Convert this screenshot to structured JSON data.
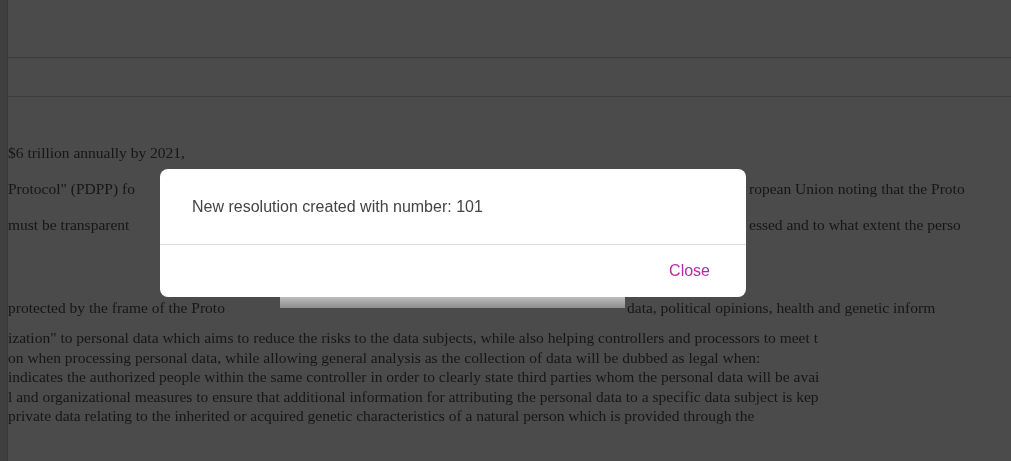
{
  "article": {
    "lines": [
      {
        "kind": "full",
        "left": "$6 trillion annually by 2021,"
      },
      {
        "kind": "split_dialog",
        "left": "Protocol\" (PDPP) fo",
        "right": "ropean Union noting that the Proto"
      },
      {
        "kind": "split_dialog",
        "left": "must be transparent",
        "right": "essed and to what extent the perso"
      },
      {
        "kind": "split_strip",
        "left": "protected by the frame of the Proto",
        "right": "data, political opinions, health and genetic inform"
      }
    ],
    "paragraph": [
      "ization\" to personal data which aims to reduce the risks to the data subjects, while also helping controllers and processors to meet t",
      "on when processing personal data, while allowing general analysis as the collection of data will be dubbed as legal when:",
      "indicates the authorized people within the same controller in order to clearly state third parties whom the personal data will be avai",
      "l and organizational measures to ensure that additional information for attributing the personal data to a specific data subject is kep",
      "private data relating to the inherited or acquired genetic characteristics of a natural person which is provided through the"
    ]
  },
  "dialog": {
    "message": "New resolution created with number: 101",
    "button": "Close"
  }
}
